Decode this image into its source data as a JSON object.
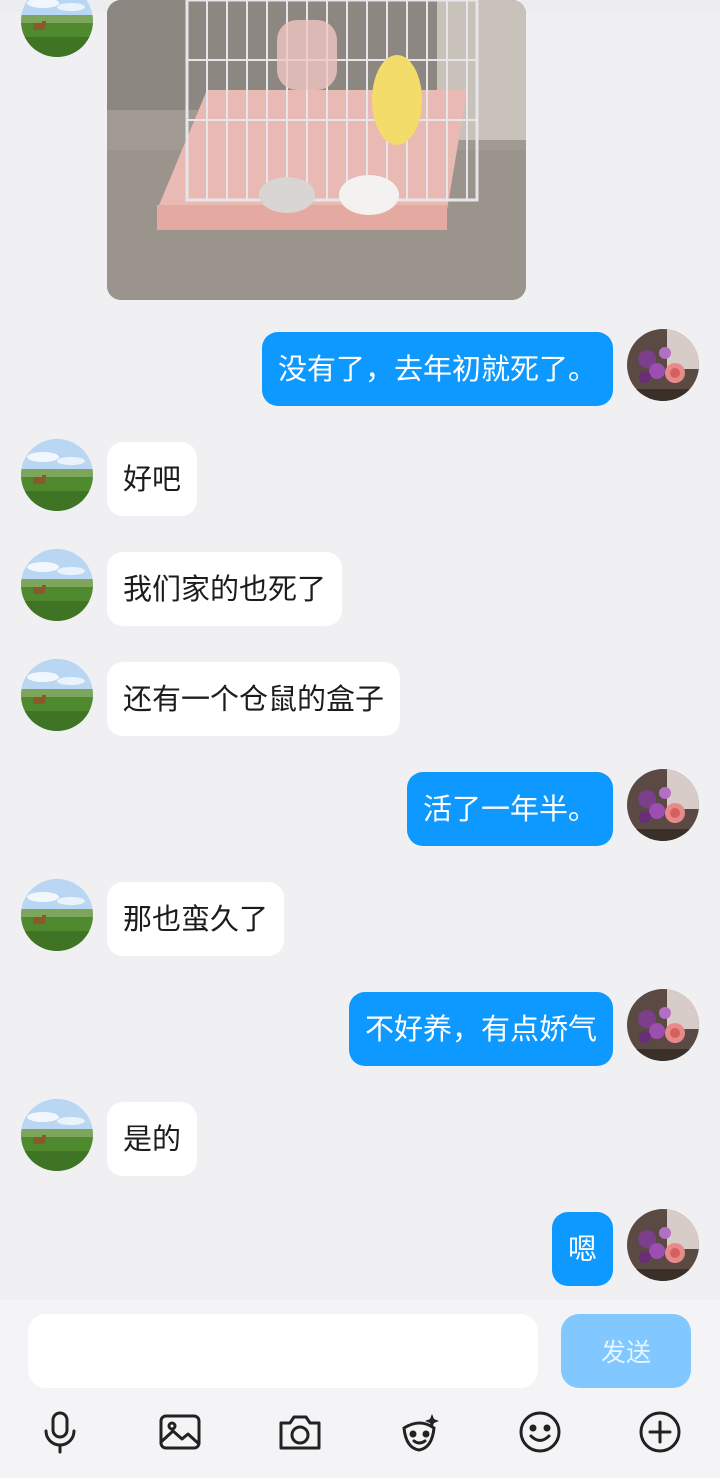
{
  "messages": [
    {
      "side": "in",
      "type": "image",
      "image_desc": "hamster-cage-photo"
    },
    {
      "side": "out",
      "text": "没有了，去年初就死了。"
    },
    {
      "side": "in",
      "text": "好吧"
    },
    {
      "side": "in",
      "text": "我们家的也死了"
    },
    {
      "side": "in",
      "text": "还有一个仓鼠的盒子"
    },
    {
      "side": "out",
      "text": "活了一年半。"
    },
    {
      "side": "in",
      "text": "那也蛮久了"
    },
    {
      "side": "out",
      "text": "不好养，有点娇气"
    },
    {
      "side": "in",
      "text": "是的"
    },
    {
      "side": "out",
      "text": "嗯"
    }
  ],
  "composer": {
    "input_value": "",
    "send_label": "发送",
    "tools": [
      "microphone-icon",
      "image-icon",
      "camera-icon",
      "sticker-icon",
      "emoji-icon",
      "plus-icon"
    ]
  },
  "colors": {
    "outgoing_bubble": "#0d99ff",
    "incoming_bubble": "#ffffff",
    "background": "#f0f0f3",
    "send_disabled": "#80c8ff"
  }
}
